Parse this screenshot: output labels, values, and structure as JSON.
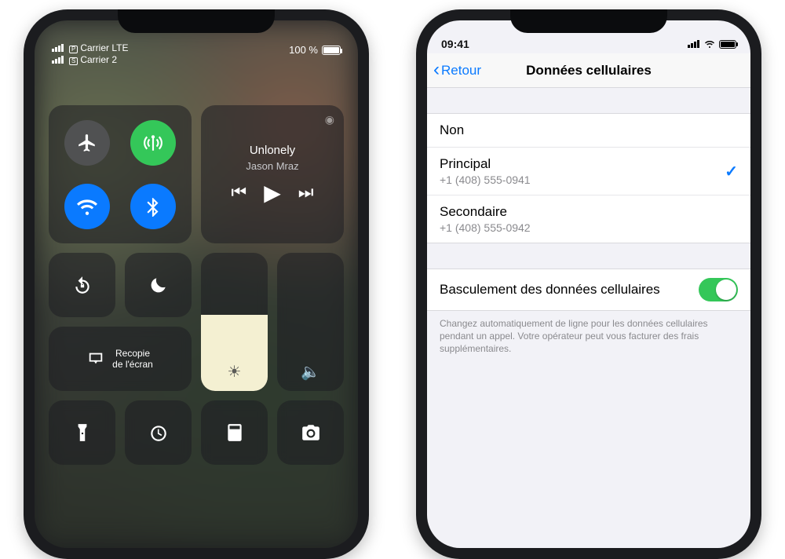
{
  "left": {
    "status": {
      "carrier1": "Carrier LTE",
      "sim1": "P",
      "carrier2": "Carrier 2",
      "sim2": "S",
      "battery": "100 %"
    },
    "music": {
      "track": "Unlonely",
      "artist": "Jason Mraz"
    },
    "recopy": {
      "line1": "Recopie",
      "line2": "de l'écran"
    }
  },
  "right": {
    "status": {
      "time": "09:41"
    },
    "nav": {
      "back": "Retour",
      "title": "Données cellulaires"
    },
    "options": {
      "none": "Non",
      "primary": {
        "label": "Principal",
        "number": "+1 (408) 555-0941"
      },
      "secondary": {
        "label": "Secondaire",
        "number": "+1 (408) 555-0942"
      }
    },
    "switch": {
      "label": "Basculement des données cellulaires",
      "footer": "Changez automatiquement de ligne pour les données cellulaires pendant un appel. Votre opérateur peut vous facturer des frais supplémentaires."
    }
  }
}
